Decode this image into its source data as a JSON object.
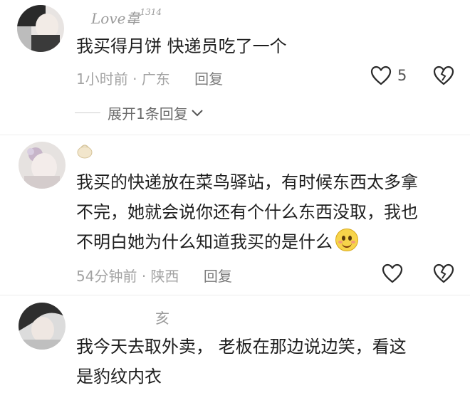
{
  "comments": [
    {
      "username": "Love韋",
      "username_suffix": "1314",
      "text_lines": [
        "我买得月饼  快递员吃了一个"
      ],
      "time": "1小时前",
      "location": "广东",
      "reply_label": "回复",
      "like_count": "5",
      "expand_label": "展开1条回复"
    },
    {
      "username": "",
      "text_lines": [
        "我买的快递放在菜鸟驿站，有时候东西太多拿",
        "不完，她就会说你还有个什么东西没取，我也",
        "不明白她为什么知道我买的是什么"
      ],
      "time": "54分钟前",
      "location": "陕西",
      "reply_label": "回复"
    },
    {
      "username": "亥",
      "text_lines": [
        "我今天去取外卖，  老板在那边说边笑，看这",
        "是豹纹内衣"
      ]
    }
  ],
  "separator_dot": "·",
  "icons": {
    "like": "heart-outline-icon",
    "dislike": "broken-heart-icon",
    "expand": "chevron-down-icon",
    "emoji": "smiling-face-emoji"
  }
}
